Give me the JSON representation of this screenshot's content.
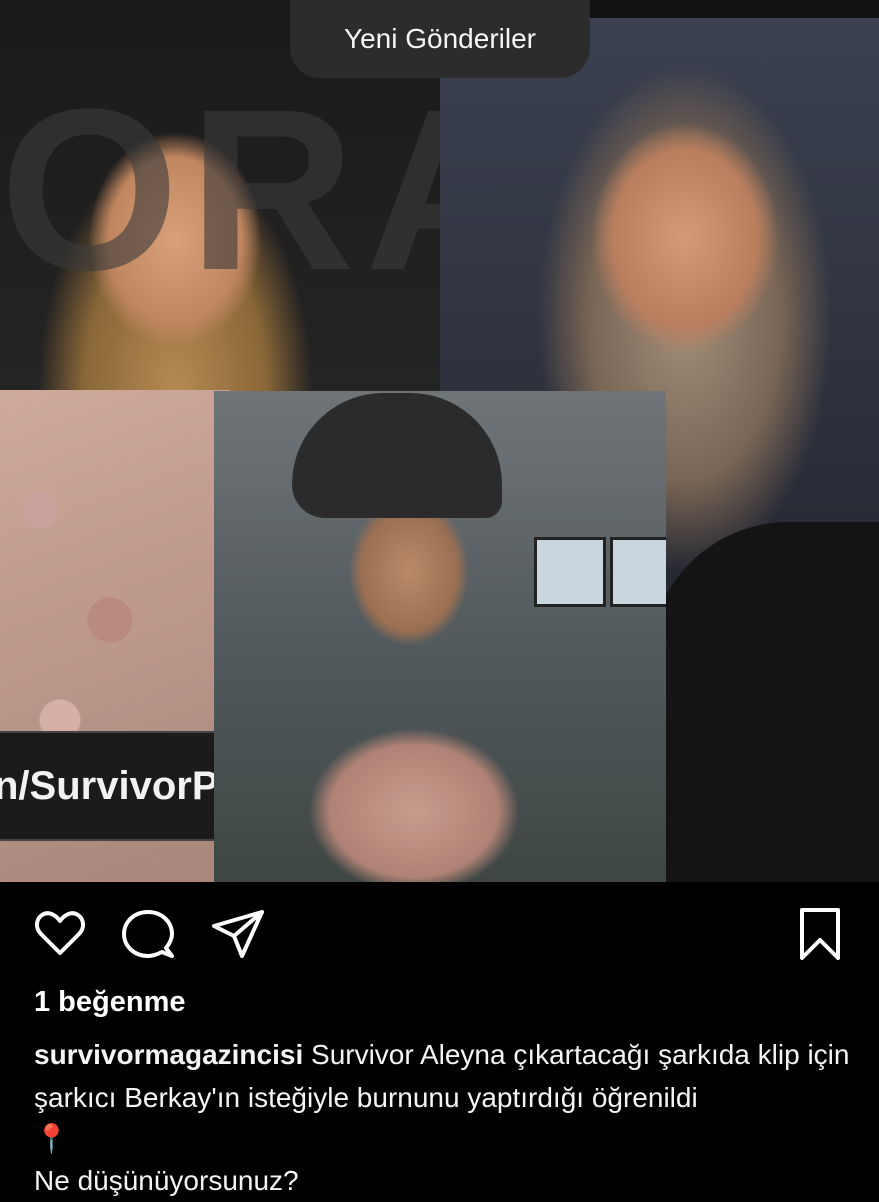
{
  "toast": {
    "label": "Yeni Gönderiler"
  },
  "post": {
    "watermark_text": "n/SurvivorPa",
    "bg_letters": "ORA",
    "likes_text": "1 beğenme",
    "caption": {
      "username": "survivormagazincisi",
      "text": "Survivor Aleyna çıkartacağı şarkıda klip için şarkıcı Berkay'ın isteğiyle burnunu yaptırdığı öğrenildi",
      "pin_emoji": "📍",
      "question": "Ne düşünüyorsunuz?"
    }
  },
  "actions": {
    "icons": [
      "heart-icon",
      "comment-icon",
      "share-icon",
      "bookmark-icon"
    ]
  }
}
